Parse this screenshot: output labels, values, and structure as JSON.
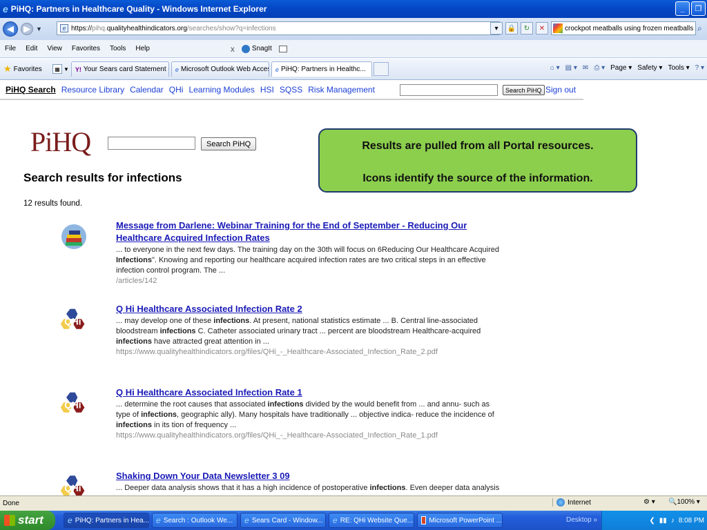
{
  "window": {
    "title": "PiHQ: Partners in Healthcare Quality - Windows Internet Explorer"
  },
  "address": {
    "scheme": "https://",
    "subdomain": "pihq.",
    "host": "qualityhealthindicators.org",
    "path": "/searches/show?q=infections"
  },
  "search_box": {
    "value": "crockpot meatballs using frozen meatballs"
  },
  "menu": [
    "File",
    "Edit",
    "View",
    "Favorites",
    "Tools",
    "Help"
  ],
  "snagit_label": "SnagIt",
  "favorites_label": "Favorites",
  "tabs": [
    {
      "label": "Your Sears card Statement - ...",
      "icon": "yahoo-icon"
    },
    {
      "label": "Microsoft Outlook Web Access",
      "icon": "ie-icon"
    },
    {
      "label": "PiHQ: Partners in Healthc...",
      "icon": "ie-icon"
    }
  ],
  "toolbar_right": {
    "page": "Page",
    "safety": "Safety",
    "tools": "Tools"
  },
  "site_nav": {
    "items": [
      "PiHQ Search",
      "Resource Library",
      "Calendar",
      "QHi",
      "Learning Modules",
      "HSI",
      "SQSS",
      "Risk Management"
    ],
    "search_button": "Search PiHQ",
    "sign_out": "Sign out"
  },
  "logo": "PiHQ",
  "main_search_button": "Search PiHQ",
  "heading": "Search results for infections",
  "results_count": "12 results found.",
  "callout": {
    "line1": "Results are pulled from all Portal resources.",
    "line2": "Icons identify the source of the information."
  },
  "results": [
    {
      "title": "Message from Darlene: Webinar Training for the End of September - Reducing Our Healthcare Acquired Infection Rates",
      "snippet_parts": [
        {
          "t": "... to everyone in the next few days. The training day on the 30th will focus on 6Reducing Our Healthcare Acquired ",
          "b": false
        },
        {
          "t": "Infections",
          "b": true
        },
        {
          "t": "\". Knowing and reporting our healthcare acquired infection rates are two critical steps in an effective infection control program. The ...",
          "b": false
        }
      ],
      "url": "/articles/142",
      "icon": "library-books-icon"
    },
    {
      "title": "Q Hi Healthcare Associated Infection Rate 2",
      "snippet_parts": [
        {
          "t": "... may develop one of these ",
          "b": false
        },
        {
          "t": "infections",
          "b": true
        },
        {
          "t": ". At present, national statistics estimate ... B. Central line-associated bloodstream ",
          "b": false
        },
        {
          "t": "infections",
          "b": true
        },
        {
          "t": " C. Catheter associated urinary tract ... percent are bloodstream Healthcare-acquired ",
          "b": false
        },
        {
          "t": "infections",
          "b": true
        },
        {
          "t": " have attracted great attention in ...",
          "b": false
        }
      ],
      "url": "https://www.qualityhealthindicators.org/files/QHi_-_Healthcare-Associated_Infection_Rate_2.pdf",
      "icon": "qhi-icon"
    },
    {
      "title": "Q Hi Healthcare Associated Infection Rate 1",
      "snippet_parts": [
        {
          "t": "... determine the root causes that associated ",
          "b": false
        },
        {
          "t": "infections",
          "b": true
        },
        {
          "t": " divided by the would benefit from ... and annu- such as type of ",
          "b": false
        },
        {
          "t": "infections",
          "b": true
        },
        {
          "t": ", geographic ally). Many hospitals have traditionally ... objective indica- reduce the incidence of ",
          "b": false
        },
        {
          "t": "infections",
          "b": true
        },
        {
          "t": " in its tion of frequency ...",
          "b": false
        }
      ],
      "url": "https://www.qualityhealthindicators.org/files/QHi_-_Healthcare-Associated_Infection_Rate_1.pdf",
      "icon": "qhi-icon"
    },
    {
      "title": "Shaking Down Your Data Newsletter 3 09",
      "snippet_parts": [
        {
          "t": "... Deeper data analysis shows that it has a high incidence of postoperative ",
          "b": false
        },
        {
          "t": "infections",
          "b": true
        },
        {
          "t": ". Even deeper data analysis",
          "b": false
        }
      ],
      "url": "",
      "icon": "qhi-icon"
    }
  ],
  "status": {
    "text": "Done",
    "zone": "Internet",
    "zoom": "100%"
  },
  "taskbar": {
    "start": "start",
    "tasks": [
      {
        "label": "PiHQ: Partners in Hea...",
        "icon": "ie-icon",
        "active": true
      },
      {
        "label": "Search : Outlook We...",
        "icon": "ie-icon",
        "active": false
      },
      {
        "label": "Sears Card - Window...",
        "icon": "ie-icon",
        "active": false
      },
      {
        "label": "RE: QHi Website Que...",
        "icon": "ie-icon",
        "active": false
      },
      {
        "label": "Microsoft PowerPoint ...",
        "icon": "powerpoint-icon",
        "active": false
      }
    ],
    "desktop": "Desktop",
    "clock": "8:08 PM"
  },
  "colors": {
    "callout_fill": "#8ccf4d",
    "callout_border": "#1f3a6e",
    "link": "#1a1ab8",
    "logo": "#7a1c1c"
  }
}
